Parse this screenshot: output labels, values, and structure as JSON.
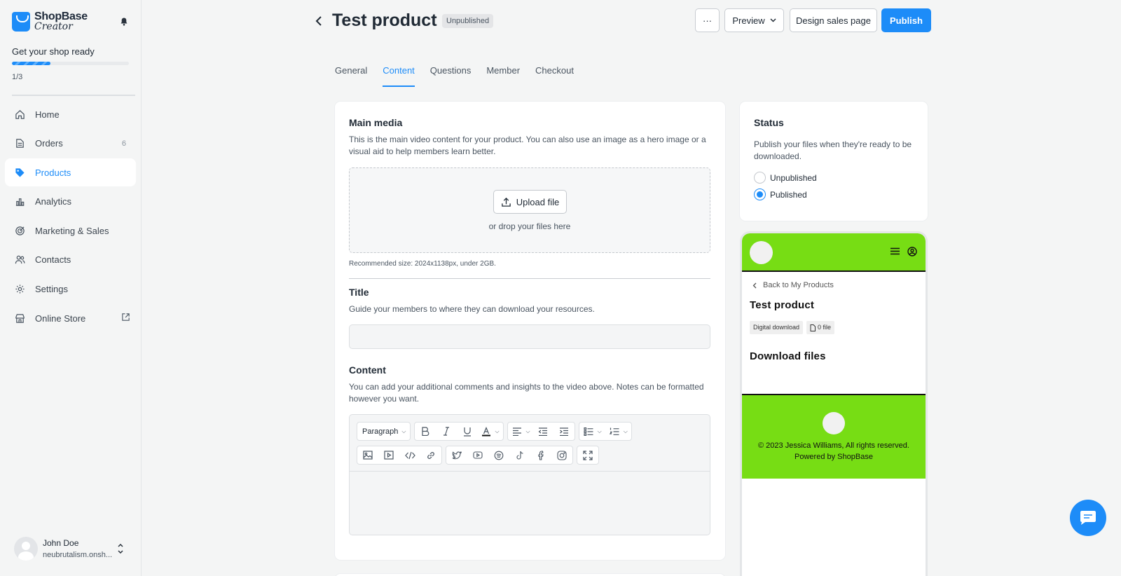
{
  "sidebar": {
    "brand_line1": "ShopBase",
    "brand_line2": "Creator",
    "shop_ready": "Get your shop ready",
    "progress_fraction": 0.33,
    "progress_count": "1/3",
    "items": [
      {
        "label": "Home",
        "icon": "home-icon"
      },
      {
        "label": "Orders",
        "icon": "orders-icon",
        "count": "6"
      },
      {
        "label": "Products",
        "icon": "tag-icon",
        "active": true
      },
      {
        "label": "Analytics",
        "icon": "bar-chart-icon"
      },
      {
        "label": "Marketing & Sales",
        "icon": "target-icon"
      },
      {
        "label": "Contacts",
        "icon": "users-icon"
      },
      {
        "label": "Settings",
        "icon": "gear-icon"
      },
      {
        "label": "Online Store",
        "icon": "store-icon"
      }
    ],
    "user": {
      "name": "John Doe",
      "store": "neubrutalism.onsh..."
    }
  },
  "header": {
    "title": "Test product",
    "status_badge": "Unpublished",
    "more_label": "···",
    "preview_label": "Preview",
    "design_label": "Design sales page",
    "publish_label": "Publish"
  },
  "tabs": [
    "General",
    "Content",
    "Questions",
    "Member",
    "Checkout"
  ],
  "active_tab": "Content",
  "main": {
    "media_title": "Main media",
    "media_desc": "This is the main video content for your product. You can also use an image as a hero image or a visual aid to help members learn better.",
    "upload_label": "Upload file",
    "drop_hint": "or drop your files here",
    "recommended": "Recommended size: 2024x1138px, under 2GB.",
    "title_label": "Title",
    "title_desc": "Guide your members to where they can download your resources.",
    "title_value": "",
    "content_label": "Content",
    "content_desc": "You can add your additional comments and insights to the video above. Notes can be formatted however you want.",
    "editor_paragraph": "Paragraph"
  },
  "status": {
    "title": "Status",
    "desc": "Publish your files when they're ready to be downloaded.",
    "options": [
      "Unpublished",
      "Published"
    ],
    "selected": "Published"
  },
  "preview": {
    "back_label": "Back to My Products",
    "product_title": "Test product",
    "tags": [
      "Digital download",
      "0 file"
    ],
    "download_heading": "Download files",
    "copyright": "© 2023 Jessica Williams, All rights reserved.",
    "powered": "Powered by ShopBase"
  },
  "colors": {
    "accent": "#1d8cf8",
    "preview_green": "#77dd14"
  }
}
